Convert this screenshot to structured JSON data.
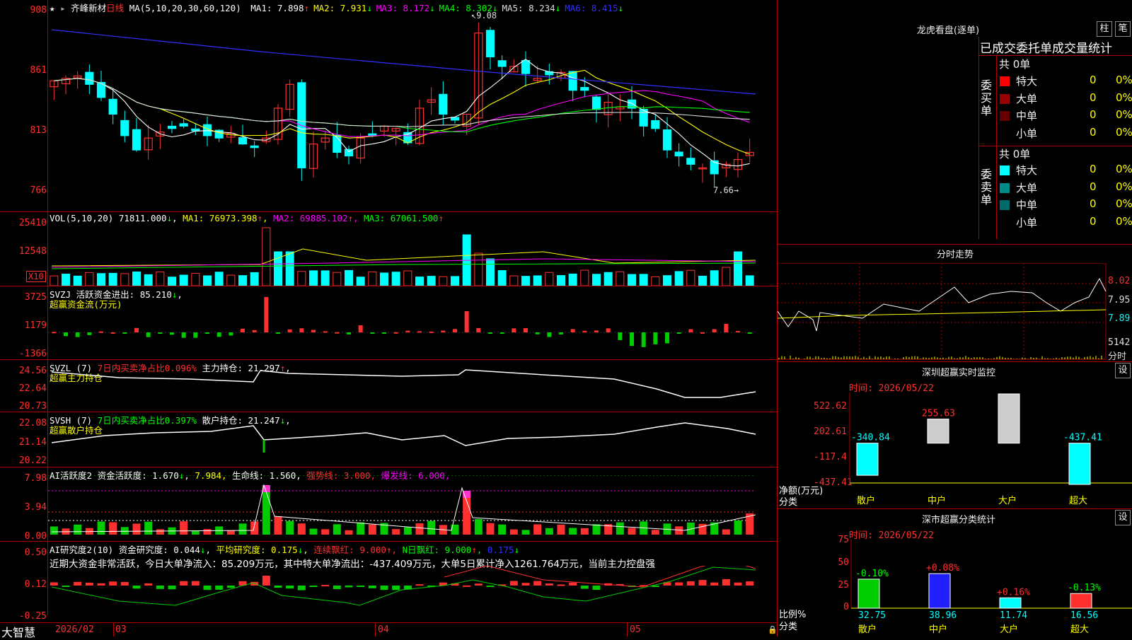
{
  "price_pane": {
    "stock_name": "齐峰新材",
    "period": "日线",
    "ma_spec": "MA(5,10,20,30,60,120)",
    "ma_items": [
      {
        "label": "MA1: 7.898",
        "arrow": "↑",
        "color": "#ffffff"
      },
      {
        "label": "MA2: 7.931",
        "arrow": "↓",
        "color": "#ffff00"
      },
      {
        "label": "MA3: 8.172",
        "arrow": "↓",
        "color": "#ff00ff"
      },
      {
        "label": "MA4: 8.302",
        "arrow": "↓",
        "color": "#00ff00"
      },
      {
        "label": "MA5: 8.234",
        "arrow": "↓",
        "color": "#dddddd"
      },
      {
        "label": "MA6: 8.415",
        "arrow": "↓",
        "color": "#3030ff"
      }
    ],
    "y_ticks": [
      "908",
      "861",
      "813",
      "766"
    ],
    "high_mark": "9.08",
    "low_mark": "7.66"
  },
  "vol_pane": {
    "title": "VOL(5,10,20)",
    "value": "71811.000",
    "value_arrow": "↓",
    "ma1": "MA1: 76973.398",
    "ma2": "MA2: 69885.102",
    "ma3": "MA3: 67061.500",
    "y_ticks": [
      "25410",
      "12548"
    ],
    "unit": "X10"
  },
  "svzj_pane": {
    "title": "SVZJ",
    "label": "活跃资金进出: 85.210",
    "arrow": "↓",
    "subtitle": "超赢资金流(万元)",
    "y_ticks": [
      "3725",
      "1179",
      "-1366"
    ]
  },
  "svzl_pane": {
    "title": "SVZL (7)",
    "ratio": "7日内买卖净占比0.096%",
    "hold": "主力持仓: 21.297",
    "arrow": "↑",
    "subtitle": "超赢主力持仓",
    "y_ticks": [
      "24.56",
      "22.64",
      "20.73"
    ]
  },
  "svsh_pane": {
    "title": "SVSH (7)",
    "ratio": "7日内买卖净占比0.397%",
    "hold": "散户持仓: 21.247",
    "arrow": "↓",
    "subtitle": "超赢散户持仓",
    "y_ticks": [
      "22.08",
      "21.14",
      "20.22"
    ]
  },
  "ai_active_pane": {
    "title": "AI活跃度2",
    "active": "资金活跃度: 1.670",
    "value2": "7.984",
    "life": "生命线: 1.560",
    "strong": "强势线: 3.000",
    "burst": "爆发线: 6.000",
    "y_ticks": [
      "7.98",
      "3.94",
      "0.00"
    ]
  },
  "ai_research_pane": {
    "title": "AI研究度2(10)",
    "research": "资金研究度: 0.044",
    "avg": "平均研究度: 0.175",
    "cont": "连续飘红: 9.000",
    "nday": "N日飘红: 9.000",
    "last": "0.175",
    "comment": "近期大资金非常活跃，今日大单净流入：85.209万元，其中特大单净流出：-437.409万元，大单5日累计净入1261.764万元，当前主力控盘强",
    "y_ticks": [
      "0.50",
      "0.12",
      "-0.25"
    ]
  },
  "x_axis": {
    "labels": [
      "2026/02",
      "03",
      "04",
      "05"
    ]
  },
  "brand": "大智慧",
  "lhkp": {
    "title": "龙虎看盘(逐单)",
    "btn_zhu": "柱",
    "btn_bi": "笔",
    "tabs": "已成交委托单成交量统计",
    "buy_label": "委买单",
    "sell_label": "委卖单",
    "buy_total": "共 0单",
    "sell_total": "共 0单",
    "buy_rows": [
      {
        "name": "特大",
        "count": "0",
        "pct": "0%",
        "color": "#ff0000"
      },
      {
        "name": "大单",
        "count": "0",
        "pct": "0%",
        "color": "#990000"
      },
      {
        "name": "中单",
        "count": "0",
        "pct": "0%",
        "color": "#660000"
      },
      {
        "name": "小单",
        "count": "0",
        "pct": "0%",
        "color": ""
      }
    ],
    "sell_rows": [
      {
        "name": "特大",
        "count": "0",
        "pct": "0%",
        "color": "#00ffff"
      },
      {
        "name": "大单",
        "count": "0",
        "pct": "0%",
        "color": "#008b8b"
      },
      {
        "name": "中单",
        "count": "0",
        "pct": "0%",
        "color": "#006a6a"
      },
      {
        "name": "小单",
        "count": "0",
        "pct": "0%",
        "color": ""
      }
    ]
  },
  "intraday": {
    "title": "分时走势",
    "prices": [
      "8.02",
      "7.95",
      "7.89"
    ],
    "vol": "5142",
    "vol_label": "分时"
  },
  "sz_monitor": {
    "title": "深圳超赢实时监控",
    "btn": "设",
    "time": "时间: 2026/05/22",
    "y_ticks": [
      "522.62",
      "202.61",
      "-117.4",
      "-437.41"
    ],
    "ylabel": "净额(万元)",
    "xlabel": "分类",
    "bars": [
      {
        "cat": "散户",
        "value": "-340.84"
      },
      {
        "cat": "中户",
        "value": "255.63"
      },
      {
        "cat": "大户",
        "value": "522.62"
      },
      {
        "cat": "超大",
        "value": "-437.41"
      }
    ]
  },
  "sz_class": {
    "title": "深市超赢分类统计",
    "btn": "设",
    "time": "时间: 2026/05/22",
    "y_ticks": [
      "75",
      "50",
      "25",
      "0"
    ],
    "ylabel": "比例%",
    "xlabel": "分类",
    "bars": [
      {
        "cat": "散户",
        "pct": "-0.10%",
        "value": "32.75"
      },
      {
        "cat": "中户",
        "pct": "+0.08%",
        "value": "38.96"
      },
      {
        "cat": "大户",
        "pct": "+0.16%",
        "value": "11.74"
      },
      {
        "cat": "超大",
        "pct": "-0.13%",
        "value": "16.56"
      }
    ]
  },
  "colors": {
    "up": "#ff3030",
    "down": "#00ffff",
    "grid": "#b00000"
  }
}
